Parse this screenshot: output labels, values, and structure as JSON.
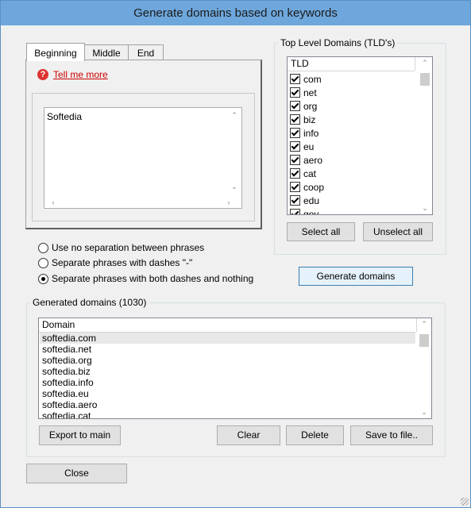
{
  "window": {
    "title": "Generate domains based on keywords"
  },
  "tabs": [
    {
      "label": "Beginning"
    },
    {
      "label": "Middle"
    },
    {
      "label": "End"
    }
  ],
  "help": {
    "link": "Tell me more"
  },
  "keywords": {
    "text": "Softedia"
  },
  "tld_group": {
    "title": "Top Level Domains (TLD's)",
    "column": "TLD",
    "items": [
      {
        "label": "com",
        "checked": true
      },
      {
        "label": "net",
        "checked": true
      },
      {
        "label": "org",
        "checked": true
      },
      {
        "label": "biz",
        "checked": true
      },
      {
        "label": "info",
        "checked": true
      },
      {
        "label": "eu",
        "checked": true
      },
      {
        "label": "aero",
        "checked": true
      },
      {
        "label": "cat",
        "checked": true
      },
      {
        "label": "coop",
        "checked": true
      },
      {
        "label": "edu",
        "checked": true
      },
      {
        "label": "gov",
        "checked": true
      }
    ],
    "select_all": "Select all",
    "unselect_all": "Unselect all"
  },
  "separation": {
    "options": [
      {
        "label": "Use no separation between phrases",
        "selected": false
      },
      {
        "label": "Separate phrases with dashes \"-\"",
        "selected": false
      },
      {
        "label": "Separate phrases with both dashes and nothing",
        "selected": true
      }
    ]
  },
  "generate_button": "Generate domains",
  "generated": {
    "title": "Generated domains (1030)",
    "column": "Domain",
    "rows": [
      "softedia.com",
      "softedia.net",
      "softedia.org",
      "softedia.biz",
      "softedia.info",
      "softedia.eu",
      "softedia.aero",
      "softedia.cat"
    ],
    "export": "Export to main",
    "clear": "Clear",
    "delete": "Delete",
    "save": "Save to file.."
  },
  "close_button": "Close"
}
